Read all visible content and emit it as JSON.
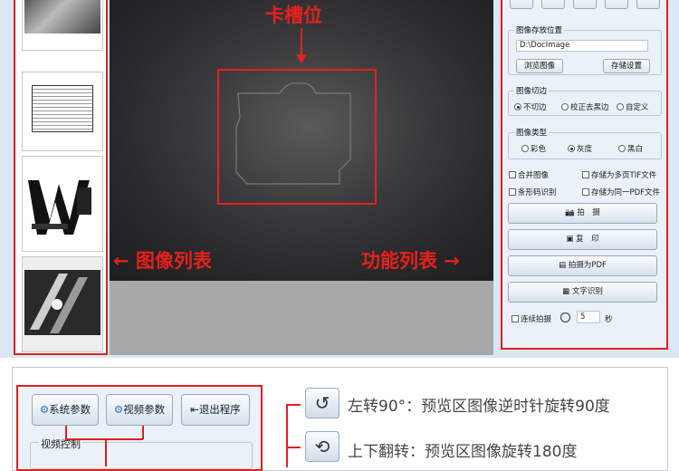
{
  "annotations": {
    "slot": "卡槽位",
    "image_list": "← 图像列表",
    "function_list": "功能列表 →"
  },
  "panel": {
    "storage": {
      "title": "图像存放位置",
      "path": "D:\\DocImage",
      "browse": "浏览图像",
      "settings": "存储设置"
    },
    "crop": {
      "title": "图像切边",
      "options": [
        "不切边",
        "校正去黑边",
        "自定义"
      ],
      "selected": "不切边"
    },
    "type": {
      "title": "图像类型",
      "options": [
        "彩色",
        "灰度",
        "黑白"
      ],
      "selected": "灰度"
    },
    "checks": [
      "合并图像",
      "存储为多页TIF文件",
      "条形码识别",
      "存储为同一PDF文件"
    ],
    "actions": [
      "拍　摄",
      "复　印",
      "拍摄为PDF",
      "文字识别"
    ],
    "continuous": {
      "label": "连续拍摄",
      "interval": "5",
      "unit": "秒"
    }
  },
  "bottom": {
    "buttons": [
      "系统参数",
      "视频参数",
      "退出程序"
    ],
    "video_control": "视频控制",
    "features": [
      {
        "icon": "rotate-left-icon",
        "text": "左转90°：预览区图像逆时针旋转90度"
      },
      {
        "icon": "flip-icon",
        "text": "上下翻转：预览区图像旋转180度"
      }
    ]
  }
}
